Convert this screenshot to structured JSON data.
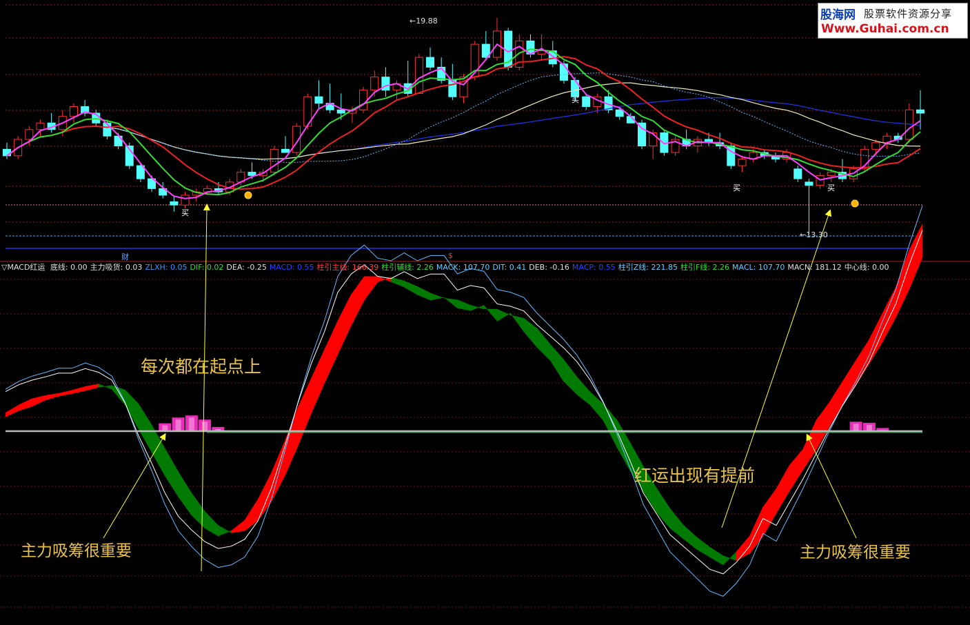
{
  "watermark": {
    "brand": "股海网",
    "tagline": "股票软件资源分享",
    "url": "Www.Guhai.com.cn"
  },
  "upper_panel": {
    "high_label": "←19.88",
    "low_label": "←13.30",
    "cai_label": "财",
    "dollar_label": "$",
    "buy_label": "买"
  },
  "indicator_bar": {
    "title": "▽MACD红运",
    "items": [
      {
        "text": "底线: 0.00",
        "color": "#e0e0e0"
      },
      {
        "text": "主力吸货: 0.03",
        "color": "#e0e0e0"
      },
      {
        "text": "ZLXH: 0.05",
        "color": "#3399ff"
      },
      {
        "text": "DIF: 0.02",
        "color": "#33dd33"
      },
      {
        "text": "DEA: -0.25",
        "color": "#e0e0e0"
      },
      {
        "text": "MACD: 0.55",
        "color": "#2244ff"
      },
      {
        "text": "柱引主线: 166.39",
        "color": "#ff4040"
      },
      {
        "text": "柱引辅线: 2.26",
        "color": "#33dd33"
      },
      {
        "text": "MACK: 107.70",
        "color": "#66ccff"
      },
      {
        "text": "DIT: 0.41",
        "color": "#66ccff"
      },
      {
        "text": "DEB: -0.16",
        "color": "#e0e0e0"
      },
      {
        "text": "MACP: 0.55",
        "color": "#2244ff"
      },
      {
        "text": "柱引Z线: 221.85",
        "color": "#66ccff"
      },
      {
        "text": "柱引F线: 2.26",
        "color": "#33dd33"
      },
      {
        "text": "MACL: 107.70",
        "color": "#66ccff"
      },
      {
        "text": "MACN: 181.12",
        "color": "#e0e0e0"
      },
      {
        "text": "中心线: 0.00",
        "color": "#e0e0e0"
      }
    ]
  },
  "annotations": {
    "start_point": "每次都在起点上",
    "early_signal": "红运出现有提前",
    "accumulation_left": "主力吸筹很重要",
    "accumulation_right": "主力吸筹很重要"
  },
  "colors": {
    "up": "#ff3030",
    "down": "#54ffff",
    "ma_magenta": "#ff40ff",
    "ma_green": "#33dd33",
    "ma_red": "#ee2222",
    "ma_blue": "#2233ee",
    "ma_cream": "#eeeebb",
    "hist_red": "#ff0000",
    "hist_green": "#007a00",
    "arrow": "#ffff33",
    "annotation": "#e8c24a"
  },
  "chart_data": [
    {
      "type": "candlestick",
      "title": "",
      "price_high": 19.88,
      "price_low": 13.3,
      "candles": [
        [
          15.9,
          16.1,
          15.6,
          15.7
        ],
        [
          15.7,
          16.3,
          15.6,
          16.2
        ],
        [
          16.2,
          16.6,
          16.0,
          16.5
        ],
        [
          16.5,
          16.8,
          16.3,
          16.7
        ],
        [
          16.7,
          17.0,
          16.4,
          16.5
        ],
        [
          16.5,
          17.1,
          16.3,
          16.9
        ],
        [
          16.9,
          17.3,
          16.7,
          17.2
        ],
        [
          17.2,
          17.4,
          16.9,
          17.0
        ],
        [
          17.0,
          17.1,
          16.6,
          16.7
        ],
        [
          16.7,
          16.8,
          16.2,
          16.3
        ],
        [
          16.3,
          16.4,
          15.9,
          16.0
        ],
        [
          16.0,
          16.1,
          15.3,
          15.4
        ],
        [
          15.4,
          15.5,
          14.9,
          15.0
        ],
        [
          15.0,
          15.1,
          14.6,
          14.7
        ],
        [
          14.7,
          14.9,
          14.4,
          14.5
        ],
        [
          14.3,
          14.5,
          14.0,
          14.2
        ],
        [
          14.2,
          14.6,
          14.1,
          14.5
        ],
        [
          14.5,
          14.7,
          14.3,
          14.6
        ],
        [
          14.6,
          14.8,
          14.5,
          14.7
        ],
        [
          14.7,
          14.9,
          14.5,
          14.6
        ],
        [
          14.6,
          15.0,
          14.5,
          14.9
        ],
        [
          14.9,
          15.3,
          14.8,
          15.2
        ],
        [
          15.2,
          15.5,
          15.0,
          15.1
        ],
        [
          15.1,
          15.3,
          14.9,
          15.2
        ],
        [
          15.2,
          16.0,
          15.1,
          15.9
        ],
        [
          15.9,
          16.3,
          15.8,
          15.8
        ],
        [
          15.8,
          16.7,
          15.7,
          16.6
        ],
        [
          16.6,
          17.6,
          16.5,
          17.5
        ],
        [
          17.5,
          18.0,
          17.1,
          17.3
        ],
        [
          17.3,
          17.9,
          17.0,
          17.1
        ],
        [
          17.1,
          17.6,
          16.8,
          17.0
        ],
        [
          17.0,
          17.2,
          16.7,
          17.1
        ],
        [
          17.1,
          17.8,
          17.0,
          17.7
        ],
        [
          17.7,
          18.3,
          17.5,
          18.1
        ],
        [
          18.1,
          18.4,
          17.5,
          17.7
        ],
        [
          17.7,
          18.0,
          17.4,
          17.9
        ],
        [
          17.9,
          18.6,
          17.5,
          17.6
        ],
        [
          17.6,
          18.8,
          17.6,
          18.7
        ],
        [
          18.7,
          19.0,
          18.3,
          18.4
        ],
        [
          18.4,
          18.7,
          17.9,
          18.0
        ],
        [
          18.0,
          18.5,
          17.4,
          17.5
        ],
        [
          17.5,
          18.2,
          17.3,
          18.1
        ],
        [
          18.1,
          19.2,
          18.0,
          19.1
        ],
        [
          19.1,
          19.5,
          18.6,
          18.7
        ],
        [
          18.7,
          19.9,
          18.6,
          19.5
        ],
        [
          19.5,
          19.6,
          18.3,
          18.4
        ],
        [
          18.4,
          19.4,
          18.3,
          19.2
        ],
        [
          19.2,
          19.4,
          18.7,
          18.8
        ],
        [
          18.8,
          19.4,
          18.6,
          18.9
        ],
        [
          18.9,
          19.2,
          18.4,
          18.5
        ],
        [
          18.5,
          18.6,
          17.9,
          18.0
        ],
        [
          18.0,
          18.1,
          17.4,
          17.5
        ],
        [
          17.5,
          17.6,
          17.1,
          17.2
        ],
        [
          17.2,
          17.6,
          17.0,
          17.5
        ],
        [
          17.5,
          17.7,
          17.0,
          17.1
        ],
        [
          17.1,
          17.2,
          16.8,
          16.9
        ],
        [
          16.9,
          17.0,
          16.7,
          16.7
        ],
        [
          16.7,
          16.8,
          15.9,
          16.0
        ],
        [
          16.0,
          16.5,
          15.6,
          16.4
        ],
        [
          16.4,
          16.5,
          15.7,
          15.8
        ],
        [
          15.8,
          16.3,
          15.7,
          16.2
        ],
        [
          16.2,
          16.5,
          15.9,
          16.0
        ],
        [
          16.0,
          16.3,
          15.8,
          16.2
        ],
        [
          16.2,
          16.4,
          16.0,
          16.1
        ],
        [
          16.1,
          16.4,
          15.9,
          16.0
        ],
        [
          16.0,
          16.1,
          15.3,
          15.4
        ],
        [
          15.4,
          15.7,
          15.2,
          15.6
        ],
        [
          15.6,
          15.9,
          15.5,
          15.8
        ],
        [
          15.8,
          15.9,
          15.6,
          15.7
        ],
        [
          15.7,
          15.8,
          15.5,
          15.6
        ],
        [
          15.6,
          15.9,
          15.5,
          15.8
        ],
        [
          15.3,
          15.4,
          14.9,
          15.0
        ],
        [
          14.9,
          15.0,
          13.3,
          14.8
        ],
        [
          14.8,
          15.2,
          14.7,
          15.1
        ],
        [
          15.1,
          15.3,
          14.9,
          15.2
        ],
        [
          15.2,
          15.6,
          14.9,
          15.0
        ],
        [
          15.0,
          15.4,
          14.9,
          15.3
        ],
        [
          15.3,
          16.0,
          15.2,
          15.9
        ],
        [
          15.9,
          16.2,
          15.7,
          16.1
        ],
        [
          16.1,
          16.4,
          15.9,
          16.3
        ],
        [
          16.3,
          16.4,
          16.1,
          16.2
        ],
        [
          16.2,
          17.3,
          16.1,
          17.1
        ],
        [
          17.1,
          17.7,
          16.5,
          17.0
        ]
      ]
    },
    {
      "type": "area",
      "title": "MACD红运",
      "hline": 0,
      "histogram": [
        0.35,
        0.5,
        0.62,
        0.68,
        0.72,
        0.78,
        0.85,
        0.9,
        0.8,
        0.5,
        0.05,
        -0.4,
        -0.85,
        -1.25,
        -1.6,
        -1.85,
        -2.0,
        -1.9,
        -1.7,
        -1.3,
        -0.8,
        -0.2,
        0.45,
        1.0,
        1.55,
        2.1,
        2.6,
        2.95,
        2.95,
        2.85,
        2.75,
        2.6,
        2.5,
        2.55,
        2.35,
        2.3,
        2.4,
        2.1,
        2.25,
        1.9,
        1.6,
        1.35,
        0.95,
        0.7,
        0.5,
        0.2,
        -0.3,
        -0.75,
        -1.15,
        -1.55,
        -1.85,
        -2.05,
        -2.25,
        -2.4,
        -2.55,
        -2.3,
        -2.0,
        -1.45,
        -1.1,
        -0.65,
        -0.35,
        0.2,
        0.55,
        0.95,
        1.35,
        1.75,
        2.25,
        2.75,
        3.45,
        3.95
      ],
      "dif": [
        0.8,
        0.95,
        1.05,
        1.12,
        1.2,
        1.2,
        1.3,
        1.22,
        1.05,
        0.55,
        -0.15,
        -0.75,
        -1.4,
        -1.9,
        -2.2,
        -2.45,
        -2.6,
        -2.55,
        -2.4,
        -2.0,
        -1.3,
        -0.4,
        0.55,
        1.4,
        2.1,
        2.95,
        3.35,
        3.55,
        3.3,
        3.25,
        3.4,
        3.25,
        3.35,
        3.35,
        3.0,
        3.1,
        3.05,
        2.7,
        2.65,
        2.55,
        2.25,
        2.0,
        1.75,
        1.45,
        1.05,
        0.55,
        -0.05,
        -0.7,
        -1.4,
        -1.85,
        -2.3,
        -2.55,
        -2.8,
        -3.05,
        -3.15,
        -2.9,
        -2.55,
        -1.95,
        -2.1,
        -1.6,
        -1.1,
        -0.55,
        0.0,
        0.5,
        0.95,
        1.45,
        2.1,
        2.7,
        3.55,
        4.3
      ],
      "accumulation": [
        0.0,
        0.0,
        0.0,
        0.0,
        0.0,
        0.0,
        0.0,
        0.0,
        0.0,
        0.0,
        0.0,
        0.0,
        0.15,
        0.26,
        0.3,
        0.22,
        0.08,
        0.0,
        0.0,
        0.0,
        0.0,
        0.0,
        0.0,
        0.0,
        0.0,
        0.0,
        0.0,
        0.0,
        0.0,
        0.0,
        0.0,
        0.0,
        0.0,
        0.0,
        0.0,
        0.0,
        0.0,
        0.0,
        0.0,
        0.0,
        0.0,
        0.0,
        0.0,
        0.0,
        0.0,
        0.0,
        0.0,
        0.0,
        0.0,
        0.0,
        0.0,
        0.0,
        0.0,
        0.0,
        0.0,
        0.0,
        0.0,
        0.0,
        0.0,
        0.0,
        0.0,
        0.0,
        0.0,
        0.0,
        0.18,
        0.16,
        0.06,
        0.0,
        0.0,
        0.0
      ]
    }
  ]
}
